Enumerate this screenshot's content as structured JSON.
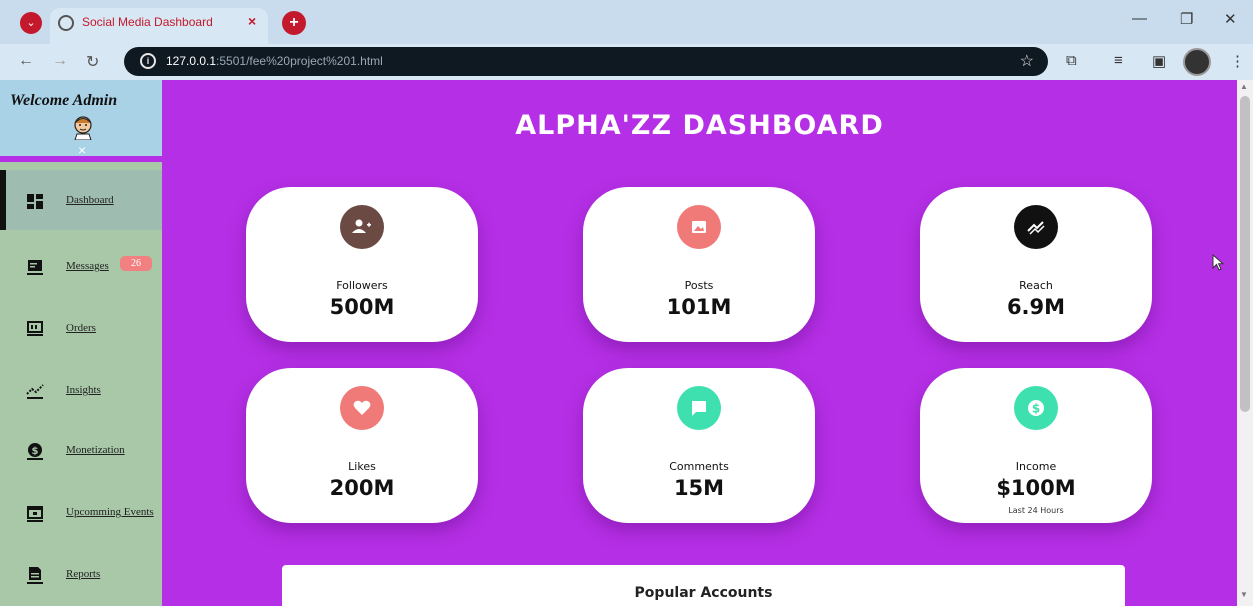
{
  "browser": {
    "tab_title": "Social Media Dashboard",
    "url_host": "127.0.0.1",
    "url_rest": ":5501/fee%20project%201.html",
    "icons": [
      "tab-search-icon",
      "globe-icon",
      "close-icon",
      "new-tab-icon",
      "minimize-icon",
      "restore-icon",
      "close-window-icon",
      "back-icon",
      "forward-icon",
      "reload-icon",
      "site-info-icon",
      "star-icon",
      "extensions-icon",
      "media-icon",
      "side-panel-icon",
      "profile-avatar"
    ]
  },
  "sidebar": {
    "welcome": "Welcome Admin",
    "close": "×",
    "items": [
      {
        "label": "Dashboard",
        "icon": "dashboard-icon",
        "active": true
      },
      {
        "label": "Messages",
        "icon": "messages-icon",
        "badge": "26"
      },
      {
        "label": "Orders",
        "icon": "orders-icon"
      },
      {
        "label": "Insights",
        "icon": "insights-icon"
      },
      {
        "label": "Monetization",
        "icon": "monetization-icon"
      },
      {
        "label": "Upcomming Events",
        "icon": "calendar-icon"
      },
      {
        "label": "Reports",
        "icon": "reports-icon"
      }
    ]
  },
  "main": {
    "title": "ALPHA'ZZ DASHBOARD",
    "cards": [
      {
        "label": "Followers",
        "value": "500M",
        "icon": "add-user-icon",
        "color": "#6b4a44"
      },
      {
        "label": "Posts",
        "value": "101M",
        "icon": "image-icon",
        "color": "#f07a78"
      },
      {
        "label": "Reach",
        "value": "6.9M",
        "icon": "trending-icon",
        "color": "#111111"
      },
      {
        "label": "Likes",
        "value": "200M",
        "icon": "heart-icon",
        "color": "#f07a78"
      },
      {
        "label": "Comments",
        "value": "15M",
        "icon": "comment-icon",
        "color": "#3ee0b0"
      },
      {
        "label": "Income",
        "value": "$100M",
        "icon": "dollar-icon",
        "color": "#3ee0b0",
        "sub": "Last 24 Hours"
      }
    ],
    "popular_title": "Popular Accounts"
  },
  "colors": {
    "page_bg": "#b52fe6",
    "sidebar_bg": "#a8c8a8",
    "sidebar_header_bg": "#a9d2e6",
    "badge": "#f38080"
  }
}
